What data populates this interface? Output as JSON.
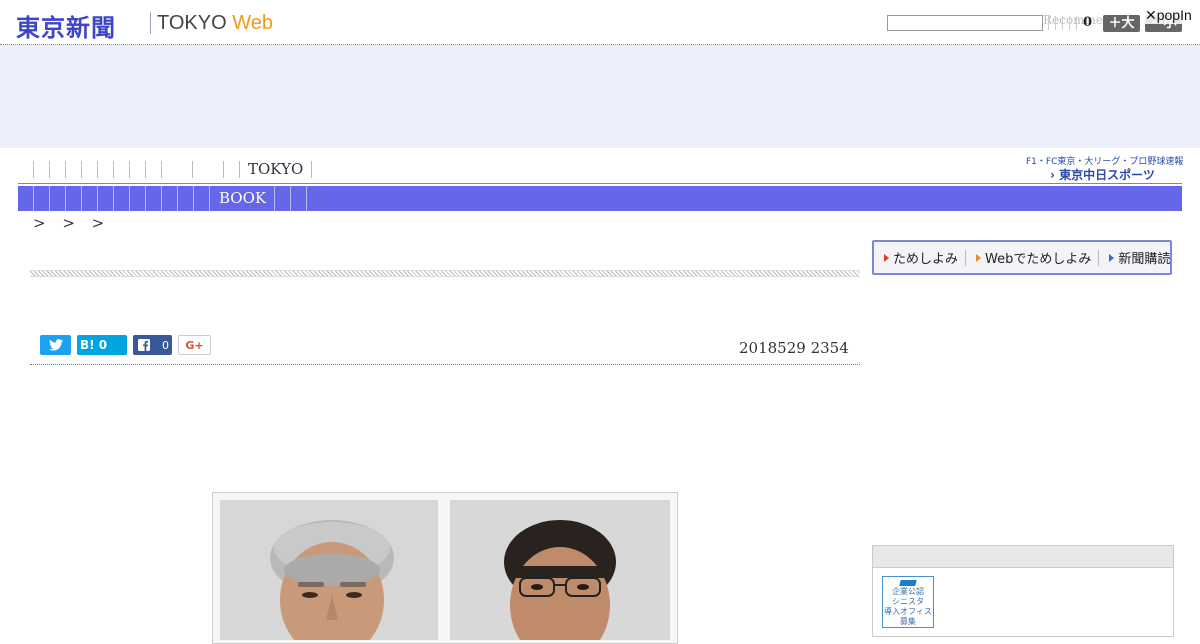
{
  "header": {
    "logo_jp": "東京新聞",
    "logo_en_prefix": "TOKYO ",
    "logo_en_web": "Web",
    "search_placeholder": "",
    "recommend_label": "Recommend",
    "count": "0",
    "btn_large": "＋大",
    "btn_small": "－小",
    "popin_label": "✕popIn"
  },
  "nav": {
    "primary_tokyo": "TOKYO",
    "secondary_book": "BOOK",
    "chunichi_line1": "F1・FC東京・大リーグ・プロ野球速報",
    "chunichi_line2": "› 東京中日スポーツ"
  },
  "breadcrumb": "> > >",
  "trial": {
    "items": [
      "ためしよみ",
      "Webでためしよみ",
      "新聞購読"
    ],
    "colors": [
      "#e03a2b",
      "#f08a2a",
      "#3a6bd6"
    ]
  },
  "share": {
    "twitter_icon": "twitter-icon",
    "hatena_label": "B! 0",
    "facebook_icon": "facebook-icon",
    "facebook_count": "0",
    "gplus_label": "G+"
  },
  "article": {
    "date": "2018529 2354"
  },
  "sidebar": {
    "banner_lines": [
      "企業公認",
      "シニスタ",
      "導入オフィス",
      "募集"
    ]
  },
  "colors": {
    "brand_blue": "#3d45c9",
    "nav_bar": "#6666ea",
    "ad_band": "#ebf0fb",
    "web_orange": "#f39a1a"
  }
}
